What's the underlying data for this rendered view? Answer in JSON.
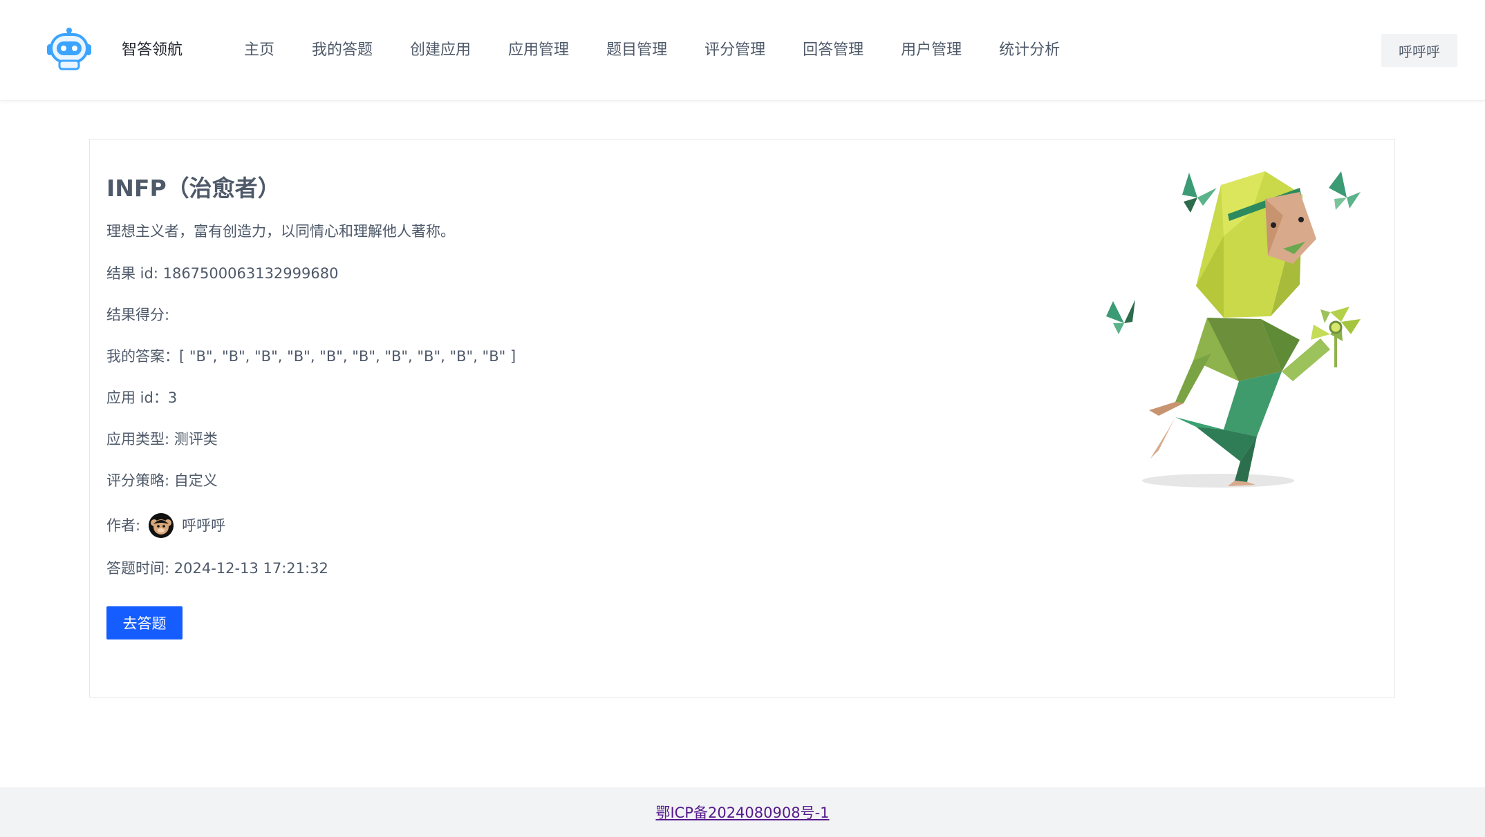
{
  "header": {
    "brand": "智答领航",
    "nav": [
      {
        "label": "主页"
      },
      {
        "label": "我的答题"
      },
      {
        "label": "创建应用"
      },
      {
        "label": "应用管理"
      },
      {
        "label": "题目管理"
      },
      {
        "label": "评分管理"
      },
      {
        "label": "回答管理"
      },
      {
        "label": "用户管理"
      },
      {
        "label": "统计分析"
      }
    ],
    "user_name": "呼呼呼"
  },
  "result": {
    "title": "INFP（治愈者）",
    "description": "理想主义者，富有创造力，以同情心和理解他人著称。",
    "id_label": "结果 id: ",
    "id_value": "1867500063132999680",
    "score_label": "结果得分:",
    "answers_label": "我的答案：",
    "answers_value": "[ \"B\", \"B\", \"B\", \"B\", \"B\", \"B\", \"B\", \"B\", \"B\", \"B\" ]",
    "app_id_label": "应用 id：",
    "app_id_value": "3",
    "app_type_label": "应用类型: ",
    "app_type_value": "测评类",
    "strategy_label": "评分策略: ",
    "strategy_value": "自定义",
    "author_label": "作者:",
    "author_name": "呼呼呼",
    "time_label": "答题时间: ",
    "time_value": "2024-12-13 17:21:32",
    "go_button": "去答题"
  },
  "footer": {
    "icp": "鄂ICP备2024080908号-1"
  },
  "colors": {
    "primary": "#165dff",
    "text": "#4e5969",
    "footer_bg": "#f2f3f5"
  }
}
